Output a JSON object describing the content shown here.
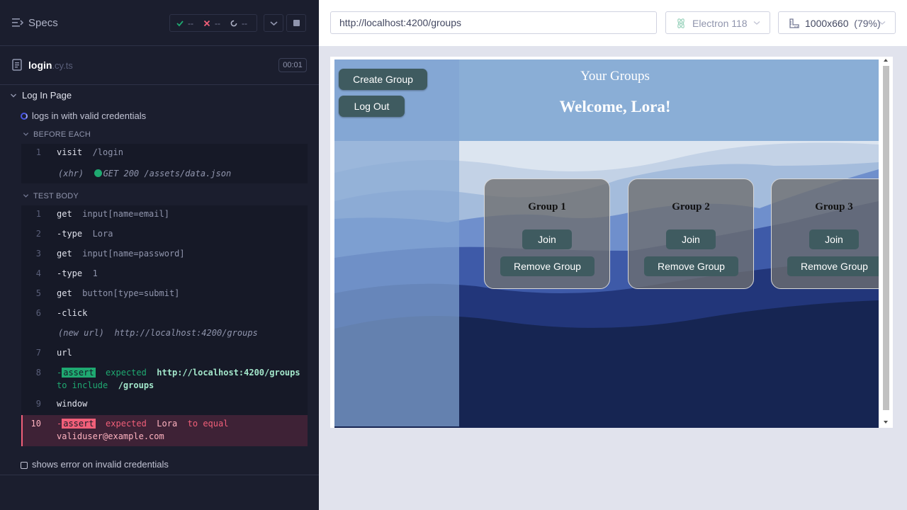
{
  "reporter": {
    "title": "Specs",
    "stats": {
      "passed": "--",
      "failed": "--",
      "pending": "--"
    },
    "file": {
      "name": "login",
      "ext": ".cy.ts",
      "timer": "00:01"
    },
    "suite": "Log In Page",
    "tests": [
      {
        "title": "logs in with valid credentials",
        "state": "running"
      },
      {
        "title": "shows error on invalid credentials",
        "state": "pending"
      }
    ],
    "before_each": {
      "title": "BEFORE EACH",
      "commands": [
        {
          "num": "1",
          "name": "visit",
          "arg": "/login"
        },
        {
          "num": "",
          "name": "(xhr)",
          "arg": "GET 200 /assets/data.json"
        }
      ]
    },
    "test_body": {
      "title": "TEST BODY",
      "commands": [
        {
          "num": "1",
          "name": "get",
          "arg": "input[name=email]"
        },
        {
          "num": "2",
          "name": "-type",
          "arg": "Lora"
        },
        {
          "num": "3",
          "name": "get",
          "arg": "input[name=password]"
        },
        {
          "num": "4",
          "name": "-type",
          "arg": "1"
        },
        {
          "num": "5",
          "name": "get",
          "arg": "button[type=submit]"
        },
        {
          "num": "6",
          "name": "-click",
          "arg": ""
        },
        {
          "num": "",
          "name": "(new url)",
          "arg": "http://localhost:4200/groups"
        },
        {
          "num": "7",
          "name": "url",
          "arg": ""
        },
        {
          "num": "8",
          "name": "-assert",
          "arg": "expected http://localhost:4200/groups to include /groups"
        },
        {
          "num": "9",
          "name": "window",
          "arg": ""
        },
        {
          "num": "10",
          "name": "-assert",
          "arg": "expected Lora to equal validuser@example.com"
        }
      ]
    },
    "assert_pass": {
      "badge": "assert",
      "expected": "expected",
      "value": "http://localhost:4200/groups",
      "verb": "to include",
      "target": "/groups"
    },
    "assert_fail": {
      "badge": "assert",
      "expected": "expected",
      "value": "Lora",
      "verb": "to equal",
      "target": "validuser@example.com"
    }
  },
  "aut": {
    "url": "http://localhost:4200/groups",
    "browser": "Electron 118",
    "viewport": "1000x660",
    "zoom": "(79%)"
  },
  "app": {
    "title": "Your Groups",
    "welcome": "Welcome, Lora!",
    "create_group": "Create Group",
    "logout": "Log Out",
    "groups": [
      {
        "name": "Group 1",
        "join": "Join",
        "remove": "Remove Group"
      },
      {
        "name": "Group 2",
        "join": "Join",
        "remove": "Remove Group"
      },
      {
        "name": "Group 3",
        "join": "Join",
        "remove": "Remove Group"
      }
    ]
  },
  "colors": {
    "reporter_bg": "#1b1e2e",
    "pass": "#1fa971",
    "fail": "#f15f79",
    "running": "#4956e3",
    "app_button": "#3f5b60"
  },
  "icons": [
    "specs-icon",
    "check-icon",
    "x-icon",
    "spinner-icon",
    "chevron-down-icon",
    "stop-icon",
    "file-icon",
    "electron-icon",
    "ruler-icon"
  ]
}
